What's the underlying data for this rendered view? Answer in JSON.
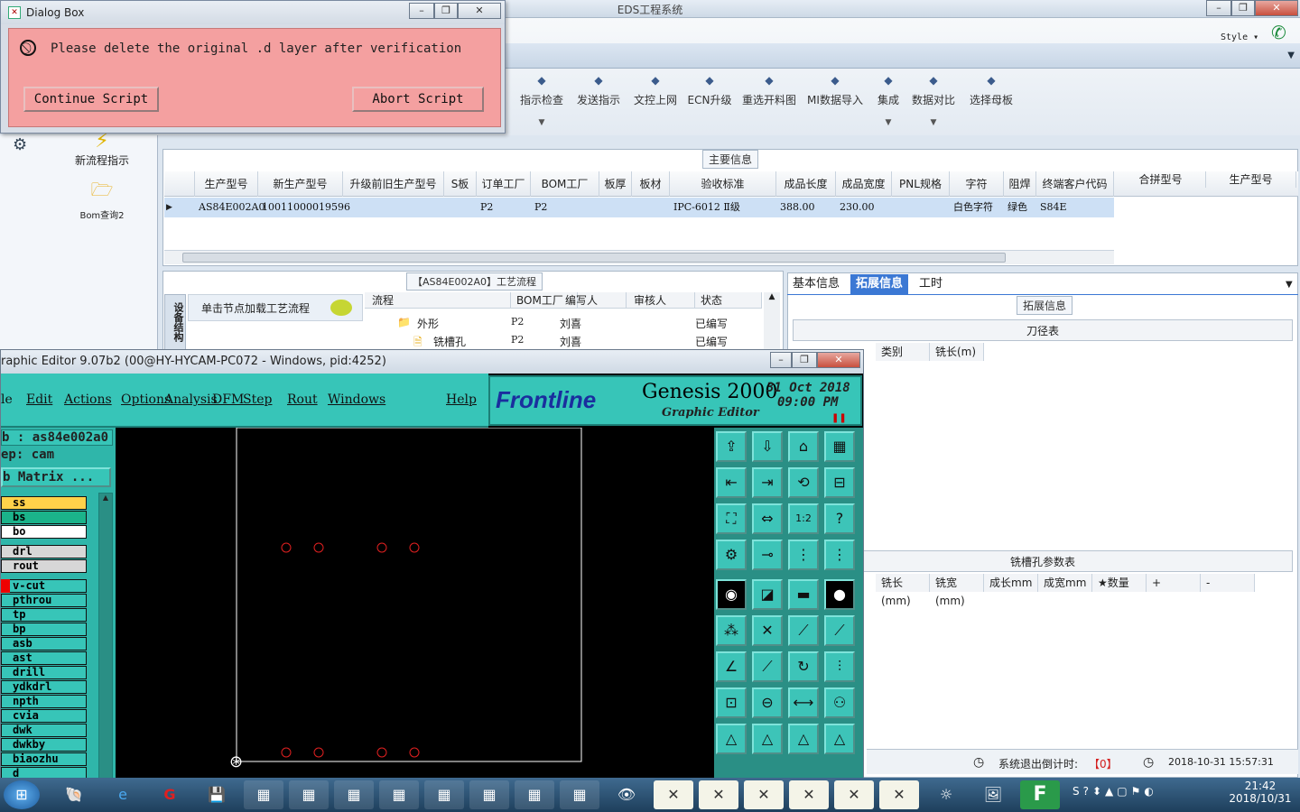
{
  "eds": {
    "title": "EDS工程系统",
    "style_label": "Style",
    "ribbon": [
      {
        "label": "指示检查",
        "icon": "check-icon"
      },
      {
        "label": "发送指示",
        "icon": "send-icon"
      },
      {
        "label": "文控上网",
        "icon": "upload-cloud-icon"
      },
      {
        "label": "ECN升级",
        "icon": "ecn-icon"
      },
      {
        "label": "重选开料图",
        "icon": "image-icon"
      },
      {
        "label": "MI数据导入",
        "icon": "import-icon"
      },
      {
        "label": "集成",
        "icon": "download-icon"
      },
      {
        "label": "数据对比",
        "icon": "compare-icon"
      },
      {
        "label": "选择母板",
        "icon": "shuffle-icon"
      }
    ],
    "left_items": [
      "新流程指示",
      "Bom查询2"
    ],
    "main_info_label": "主要信息",
    "grid": {
      "headers": [
        "生产型号",
        "新生产型号",
        "升级前旧生产型号",
        "S板",
        "订单工厂",
        "BOM工厂",
        "板厚",
        "板材",
        "验收标准",
        "成品长度",
        "成品宽度",
        "PNL规格",
        "字符",
        "阻焊",
        "终端客户代码"
      ],
      "extra_headers": [
        "合拼型号",
        "生产型号"
      ],
      "row": [
        "AS84E002A0",
        "10011000019596",
        "",
        "",
        "P2",
        "P2",
        "",
        "",
        "IPC-6012 Ⅱ级",
        "388.00",
        "230.00",
        "",
        "白色字符",
        "绿色",
        "S84E"
      ]
    },
    "flow": {
      "title": "【AS84E002A0】工艺流程",
      "side_tab": "设备结构",
      "hint": "单击节点加载工艺流程",
      "headers": [
        "流程",
        "BOM工厂",
        "编写人",
        "审核人",
        "状态"
      ],
      "rows": [
        {
          "name": "外形",
          "factory": "P2",
          "writer": "刘喜",
          "status": "已编写"
        },
        {
          "name": "铣槽孔",
          "factory": "P2",
          "writer": "刘喜",
          "status": "已编写"
        }
      ]
    },
    "tabs": [
      "基本信息",
      "拓展信息",
      "工时"
    ],
    "ext_label": "拓展信息",
    "tool_table": {
      "title": "刀径表",
      "headers": [
        "类别",
        "铣长(m)"
      ]
    },
    "slot_table": {
      "title": "铣槽孔参数表",
      "headers": [
        "铣长(mm)",
        "铣宽(mm)",
        "成长mm",
        "成宽mm",
        "★数量",
        "+",
        "-"
      ]
    },
    "status": {
      "countdown_label": "系统退出倒计时:",
      "countdown_value": "【0】",
      "datetime": "2018-10-31 15:57:31"
    }
  },
  "dialog": {
    "title": "Dialog Box",
    "message": "Please delete the original .d layer after verification",
    "continue_label": "Continue Script",
    "abort_label": "Abort Script"
  },
  "genesis": {
    "title": "raphic Editor 9.07b2 (00@HY-HYCAM-PC072 - Windows, pid:4252)",
    "menu": [
      "le",
      "Edit",
      "Actions",
      "Options",
      "Analysis",
      "DFM",
      "Step",
      "Rout",
      "Windows",
      "Help"
    ],
    "brand": "Frontline",
    "product": "Genesis 2000",
    "subtitle": "Graphic Editor",
    "date": "31 Oct 2018",
    "time": "09:00 PM",
    "job_line": "b : as84e002a0",
    "step_line": "ep: cam",
    "matrix_label": "b Matrix ...",
    "layers": [
      "ss",
      "bs",
      "bo",
      "drl",
      "rout",
      "v-cut",
      "pthrou",
      "tp",
      "bp",
      "asb",
      "ast",
      "drill",
      "ydkdrl",
      "npth",
      "cvia",
      "dwk",
      "dwkby",
      "biaozhu",
      "d"
    ],
    "layer_colors": [
      "#ffd24a",
      "#1bb38a",
      "#ffffff",
      "#d7d7d7",
      "#d7d7d7",
      "#37c5b8",
      "#37c5b8",
      "#37c5b8",
      "#37c5b8",
      "#37c5b8",
      "#37c5b8",
      "#37c5b8",
      "#37c5b8",
      "#37c5b8",
      "#37c5b8",
      "#37c5b8",
      "#37c5b8",
      "#37c5b8",
      "#37c5b8"
    ]
  },
  "taskbar": {
    "clock_time": "21:42",
    "clock_date": "2018/10/31"
  }
}
